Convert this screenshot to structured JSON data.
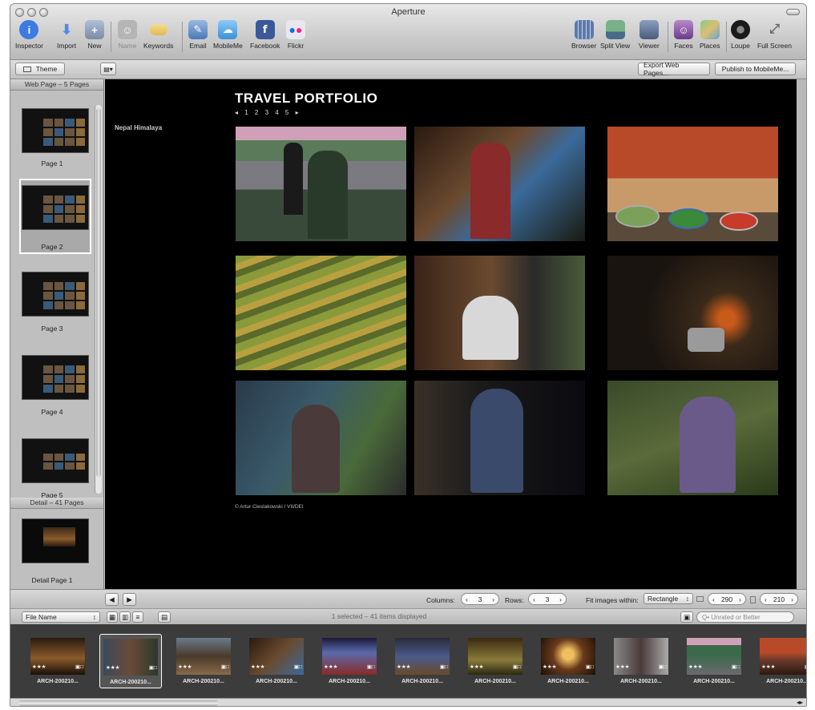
{
  "window": {
    "title": "Aperture"
  },
  "toolbar": {
    "left": [
      {
        "label": "Inspector",
        "icon": "info-icon",
        "color": "#3d7be0"
      },
      {
        "label": "Import",
        "icon": "import-arrow-icon",
        "color": "#4f8ee8"
      },
      {
        "label": "New",
        "icon": "new-folder-icon",
        "color": "#7a8aa8"
      },
      {
        "label": "Name",
        "icon": "person-icon",
        "color": "#9a9a9a"
      },
      {
        "label": "Keywords",
        "icon": "tag-icon",
        "color": "#e8c060"
      },
      {
        "label": "Email",
        "icon": "email-icon",
        "color": "#5a8ac8"
      },
      {
        "label": "MobileMe",
        "icon": "cloud-icon",
        "color": "#4aa0e0"
      },
      {
        "label": "Facebook",
        "icon": "facebook-icon",
        "color": "#3b5998"
      },
      {
        "label": "Flickr",
        "icon": "flickr-icon",
        "color": "#7a8a9a"
      }
    ],
    "right": [
      {
        "label": "Browser",
        "icon": "grid-icon",
        "color": "#5a7ab0"
      },
      {
        "label": "Split View",
        "icon": "split-view-icon",
        "color": "#5a8a6a"
      },
      {
        "label": "Viewer",
        "icon": "viewer-icon",
        "color": "#6a7a9a"
      },
      {
        "label": "Faces",
        "icon": "faces-icon",
        "color": "#8a5aa0"
      },
      {
        "label": "Places",
        "icon": "map-icon",
        "color": "#5a9a5a"
      },
      {
        "label": "Loupe",
        "icon": "loupe-icon",
        "color": "#2a2a2a"
      },
      {
        "label": "Full Screen",
        "icon": "fullscreen-icon",
        "color": "#7a7a7a"
      }
    ]
  },
  "subbar": {
    "theme_label": "Theme",
    "export_label": "Export Web Pages...",
    "publish_label": "Publish to MobileMe..."
  },
  "sidebar": {
    "webpage_header": "Web Page – 5 Pages",
    "pages": [
      "Page 1",
      "Page 2",
      "Page 3",
      "Page 4",
      "Page 5"
    ],
    "detail_header": "Detail – 41 Pages",
    "detail_pages": [
      "Detail Page 1"
    ]
  },
  "webpage": {
    "title": "TRAVEL PORTFOLIO",
    "nav": "◂ 1 2 3 4 5 ▸",
    "album": "Nepal Himalaya",
    "credit": "© Artur Cieslakowski / VII/DEI"
  },
  "controls": {
    "columns_label": "Columns:",
    "columns_value": "3",
    "rows_label": "Rows:",
    "rows_value": "3",
    "fit_label": "Fit images within:",
    "fit_value": "Rectangle",
    "width_value": "290",
    "height_value": "210"
  },
  "sortbar": {
    "sort_value": "File Name",
    "status": "1 selected – 41 items displayed",
    "search_placeholder": "Q• Unrated or Better"
  },
  "browser_items": [
    {
      "name": "ARCH-200210...",
      "rating": "★★★"
    },
    {
      "name": "ARCH-200210...",
      "rating": "★★★"
    },
    {
      "name": "ARCH-200210...",
      "rating": "★★★"
    },
    {
      "name": "ARCH-200210...",
      "rating": "★★★"
    },
    {
      "name": "ARCH-200210...",
      "rating": "★★★"
    },
    {
      "name": "ARCH-200210...",
      "rating": "★★★"
    },
    {
      "name": "ARCH-200210...",
      "rating": "★★★"
    },
    {
      "name": "ARCH-200210...",
      "rating": "★★★"
    },
    {
      "name": "ARCH-200210...",
      "rating": "★★★"
    },
    {
      "name": "ARCH-200210...",
      "rating": "★★★"
    },
    {
      "name": "ARCH-200210...",
      "rating": "★★★"
    }
  ]
}
